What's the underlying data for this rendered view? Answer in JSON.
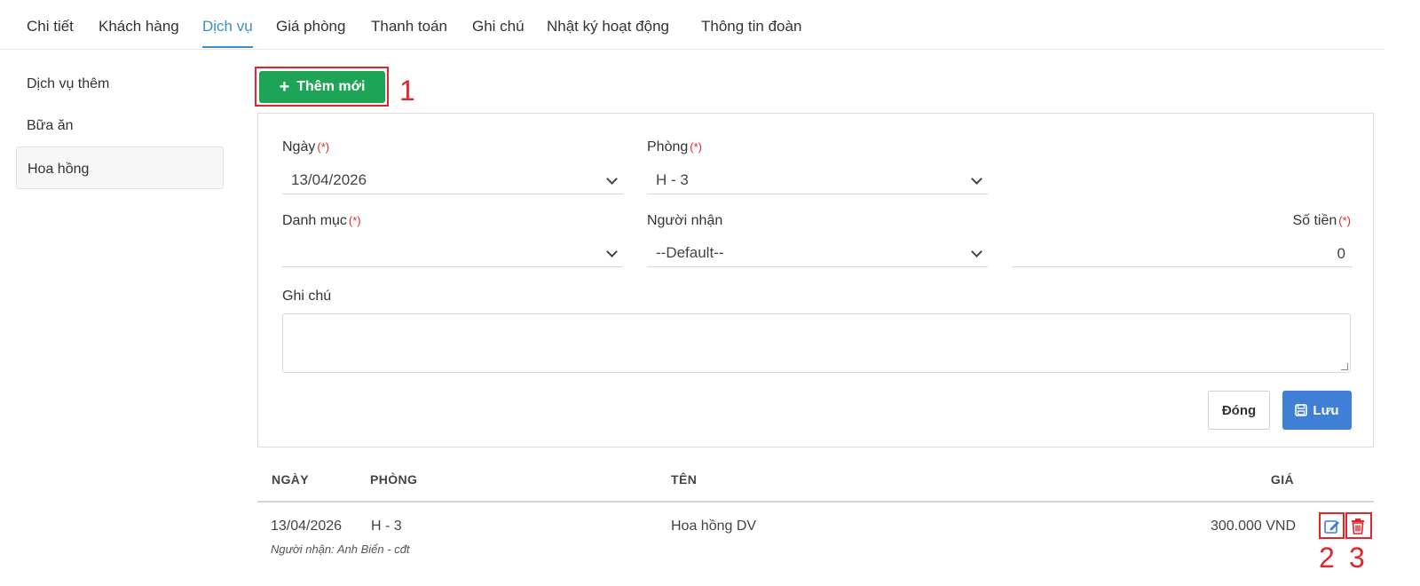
{
  "tabs": [
    "Chi tiết",
    "Khách hàng",
    "Dịch vụ",
    "Giá phòng",
    "Thanh toán",
    "Ghi chú",
    "Nhật ký hoạt động",
    "Thông tin đoàn"
  ],
  "sidebar": [
    "Dịch vụ thêm",
    "Bữa ăn",
    "Hoa hồng"
  ],
  "add_button": "Thêm mới",
  "annotations": [
    "1",
    "2",
    "3"
  ],
  "form": {
    "required_mark": "(*)",
    "date_label": "Ngày",
    "date_value": "13/04/2026",
    "room_label": "Phòng",
    "room_value": "H - 3",
    "category_label": "Danh mục",
    "category_value": "",
    "receiver_label": "Người nhận",
    "receiver_value": "--Default--",
    "amount_label": "Số tiền",
    "amount_value": "0",
    "note_label": "Ghi chú",
    "close_button": "Đóng",
    "save_button": "Lưu"
  },
  "table": {
    "headers": [
      "NGÀY",
      "PHÒNG",
      "TÊN",
      "GIÁ"
    ],
    "row": {
      "date": "13/04/2026",
      "room": "H - 3",
      "name": "Hoa hồng DV",
      "price": "300.000 VND",
      "receiver": "Người nhận: Anh Biển - cđt"
    }
  },
  "colors": {
    "accent": "#3b8fc4",
    "add_green": "#1ea456",
    "save_blue": "#3f7fd6",
    "annotation_red": "#e3252b"
  }
}
